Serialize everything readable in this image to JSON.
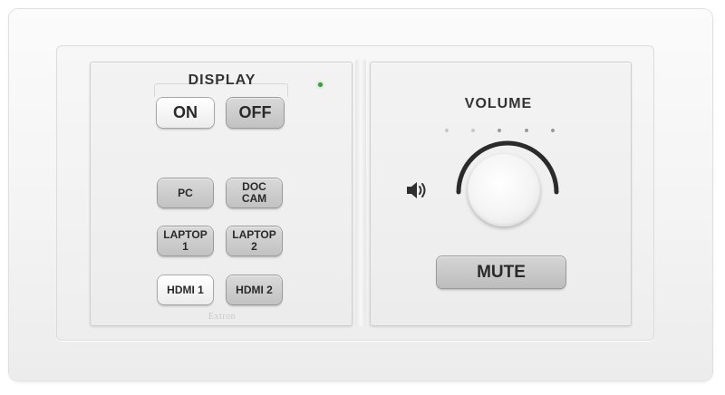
{
  "display": {
    "label": "DISPLAY",
    "on_label": "ON",
    "off_label": "OFF"
  },
  "sources": [
    {
      "label": "PC"
    },
    {
      "label": "DOC\nCAM"
    },
    {
      "label": "LAPTOP\n1"
    },
    {
      "label": "LAPTOP\n2"
    },
    {
      "label": "HDMI 1"
    },
    {
      "label": "HDMI 2"
    }
  ],
  "volume": {
    "label": "VOLUME",
    "level_dots_total": 5,
    "mute_label": "MUTE"
  },
  "brand": {
    "text": "Extron"
  },
  "colors": {
    "led": "#3c9a3c",
    "arc": "#2b2b2b"
  }
}
